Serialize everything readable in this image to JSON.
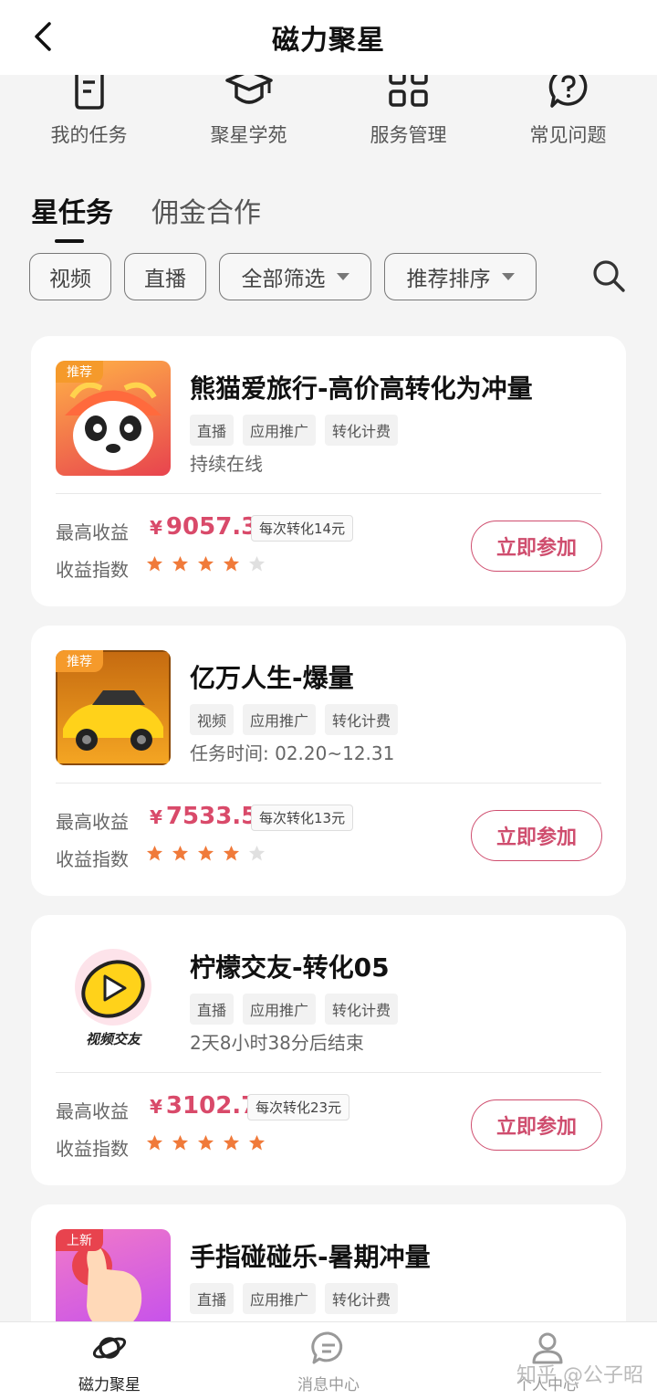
{
  "header": {
    "title": "磁力聚星"
  },
  "quick_nav": [
    {
      "label": "我的任务",
      "icon": "document-icon"
    },
    {
      "label": "聚星学苑",
      "icon": "graduation-cap-icon"
    },
    {
      "label": "服务管理",
      "icon": "grid-icon"
    },
    {
      "label": "常见问题",
      "icon": "question-icon"
    }
  ],
  "tabs": [
    {
      "label": "星任务",
      "active": true
    },
    {
      "label": "佣金合作",
      "active": false
    }
  ],
  "filters": {
    "video": "视频",
    "live": "直播",
    "all_filter": "全部筛选",
    "sort": "推荐排序"
  },
  "labels": {
    "max_income": "最高收益",
    "income_index": "收益指数",
    "join": "立即参加",
    "currency": "¥"
  },
  "tasks": [
    {
      "title": "熊猫爱旅行-高价高转化为冲量",
      "badge": "推荐",
      "tags": [
        "直播",
        "应用推广",
        "转化计费"
      ],
      "status": "持续在线",
      "max_income": "9057.3",
      "per_conversion": "每次转化14元",
      "rating": 4
    },
    {
      "title": "亿万人生-爆量",
      "badge": "推荐",
      "tags": [
        "视频",
        "应用推广",
        "转化计费"
      ],
      "status": "任务时间: 02.20~12.31",
      "max_income": "7533.5",
      "per_conversion": "每次转化13元",
      "rating": 4
    },
    {
      "title": "柠檬交友-转化05",
      "badge": "",
      "thumb_text": "视频交友",
      "tags": [
        "直播",
        "应用推广",
        "转化计费"
      ],
      "status": "2天8小时38分后结束",
      "max_income": "3102.7",
      "per_conversion": "每次转化23元",
      "rating": 5
    },
    {
      "title": "手指碰碰乐-暑期冲量",
      "badge": "上新",
      "tags": [
        "直播",
        "应用推广",
        "转化计费"
      ]
    }
  ],
  "bottom_nav": [
    {
      "label": "磁力聚星",
      "icon": "planet-icon",
      "active": true
    },
    {
      "label": "消息中心",
      "icon": "message-icon",
      "active": false
    },
    {
      "label": "个人中心",
      "icon": "user-icon",
      "active": false
    }
  ],
  "watermark": "知乎 @公子昭",
  "colors": {
    "accent": "#cf4d6e",
    "star": "#f07a3a",
    "star_off": "#e0e0e0",
    "badge_orange": "#f59a2b",
    "badge_red": "#e8434e"
  }
}
